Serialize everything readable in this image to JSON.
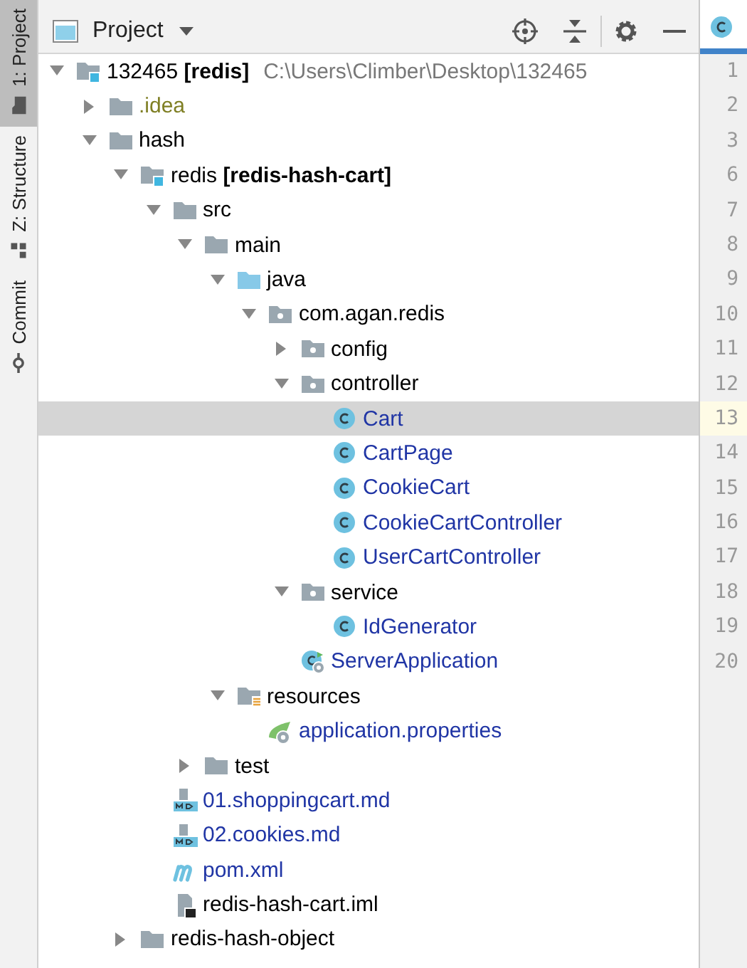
{
  "tool_strip": {
    "tabs": [
      {
        "label": "1: Project",
        "kind": "project",
        "selected": true
      },
      {
        "label": "Z: Structure",
        "kind": "structure",
        "selected": false
      },
      {
        "label": "Commit",
        "kind": "commit",
        "selected": false
      }
    ]
  },
  "panel": {
    "title": "Project"
  },
  "tree": [
    {
      "name": "132465 **[redis]**",
      "path": "C:\\Users\\Climber\\Desktop\\132465",
      "kind": "module",
      "color": "#000000",
      "expanded": true,
      "selected": false,
      "children": [
        {
          "name": ".idea",
          "kind": "folder",
          "color": "#7f7f24",
          "expanded": false,
          "selected": false
        },
        {
          "name": "hash",
          "kind": "folder",
          "color": "#000000",
          "expanded": true,
          "selected": false,
          "children": [
            {
              "name": "redis **[redis-hash-cart]**",
              "kind": "module",
              "color": "#000000",
              "expanded": true,
              "selected": false,
              "children": [
                {
                  "name": "src",
                  "kind": "folder",
                  "color": "#000000",
                  "expanded": true,
                  "selected": false,
                  "children": [
                    {
                      "name": "main",
                      "kind": "folder",
                      "color": "#000000",
                      "expanded": true,
                      "selected": false,
                      "children": [
                        {
                          "name": "java",
                          "kind": "source",
                          "color": "#000000",
                          "expanded": true,
                          "selected": false,
                          "children": [
                            {
                              "name": "com.agan.redis",
                              "kind": "package",
                              "color": "#000000",
                              "expanded": true,
                              "selected": false,
                              "children": [
                                {
                                  "name": "config",
                                  "kind": "package",
                                  "color": "#000000",
                                  "expanded": false,
                                  "selected": false
                                },
                                {
                                  "name": "controller",
                                  "kind": "package",
                                  "color": "#000000",
                                  "expanded": true,
                                  "selected": false,
                                  "children": [
                                    {
                                      "name": "Cart",
                                      "kind": "class",
                                      "color": "#2035a5",
                                      "selected": true
                                    },
                                    {
                                      "name": "CartPage",
                                      "kind": "class",
                                      "color": "#2035a5",
                                      "selected": false
                                    },
                                    {
                                      "name": "CookieCart",
                                      "kind": "class",
                                      "color": "#2035a5",
                                      "selected": false
                                    },
                                    {
                                      "name": "CookieCartController",
                                      "kind": "class",
                                      "color": "#2035a5",
                                      "selected": false
                                    },
                                    {
                                      "name": "UserCartController",
                                      "kind": "class",
                                      "color": "#2035a5",
                                      "selected": false
                                    }
                                  ]
                                },
                                {
                                  "name": "service",
                                  "kind": "package",
                                  "color": "#000000",
                                  "expanded": true,
                                  "selected": false,
                                  "children": [
                                    {
                                      "name": "IdGenerator",
                                      "kind": "class",
                                      "color": "#2035a5",
                                      "selected": false
                                    }
                                  ]
                                },
                                {
                                  "name": "ServerApplication",
                                  "kind": "app",
                                  "color": "#2035a5",
                                  "selected": false
                                }
                              ]
                            }
                          ]
                        },
                        {
                          "name": "resources",
                          "kind": "resources",
                          "color": "#000000",
                          "expanded": true,
                          "selected": false,
                          "children": [
                            {
                              "name": "application.properties",
                              "kind": "properties",
                              "color": "#2035a5",
                              "selected": false
                            }
                          ]
                        }
                      ]
                    },
                    {
                      "name": "test",
                      "kind": "folder",
                      "color": "#000000",
                      "expanded": false,
                      "selected": false
                    }
                  ]
                },
                {
                  "name": "01.shoppingcart.md",
                  "kind": "markdown",
                  "color": "#2035a5",
                  "selected": false
                },
                {
                  "name": "02.cookies.md",
                  "kind": "markdown",
                  "color": "#2035a5",
                  "selected": false
                },
                {
                  "name": "pom.xml",
                  "kind": "maven",
                  "color": "#2035a5",
                  "selected": false
                },
                {
                  "name": "redis-hash-cart.iml",
                  "kind": "iml",
                  "color": "#000000",
                  "selected": false
                }
              ]
            },
            {
              "name": "redis-hash-object",
              "kind": "folder",
              "color": "#000000",
              "expanded": false,
              "selected": false
            }
          ]
        }
      ]
    }
  ],
  "editor": {
    "tabs": [
      {
        "kind": "class",
        "selected": true
      }
    ],
    "lines": [
      {
        "number": "1",
        "current": false
      },
      {
        "number": "2",
        "current": false
      },
      {
        "number": "3",
        "current": false
      },
      {
        "number": "6",
        "current": false
      },
      {
        "number": "7",
        "current": false
      },
      {
        "number": "8",
        "current": false
      },
      {
        "number": "9",
        "current": false
      },
      {
        "number": "10",
        "current": false
      },
      {
        "number": "11",
        "current": false
      },
      {
        "number": "12",
        "current": false
      },
      {
        "number": "13",
        "current": true
      },
      {
        "number": "14",
        "current": false
      },
      {
        "number": "15",
        "current": false
      },
      {
        "number": "16",
        "current": false
      },
      {
        "number": "17",
        "current": false
      },
      {
        "number": "18",
        "current": false
      },
      {
        "number": "19",
        "current": false
      },
      {
        "number": "20",
        "current": false
      }
    ]
  }
}
